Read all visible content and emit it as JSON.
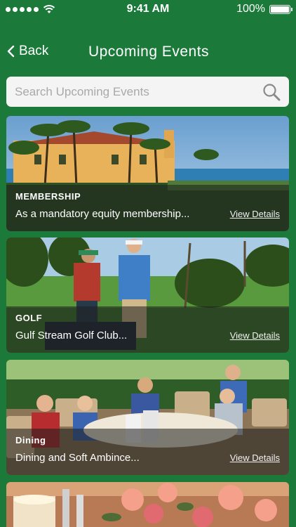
{
  "status": {
    "time": "9:41 AM",
    "battery": "100%",
    "battery_level": 1.0
  },
  "nav": {
    "back_label": "Back",
    "title": "Upcoming Events"
  },
  "search": {
    "placeholder": "Search Upcoming Events"
  },
  "events": [
    {
      "category": "MEMBERSHIP",
      "description": "As a mandatory equity membership...",
      "link": "View Details"
    },
    {
      "category": "GOLF",
      "description": "Gulf Stream Golf Club...",
      "link": "View Details"
    },
    {
      "category": "Dining",
      "description": "Dining and Soft Ambince...",
      "link": "View Details"
    }
  ],
  "colors": {
    "background": "#1b7a3a",
    "search_bg": "#f4f4f4",
    "overlay": "rgba(30,30,30,0.55)"
  }
}
